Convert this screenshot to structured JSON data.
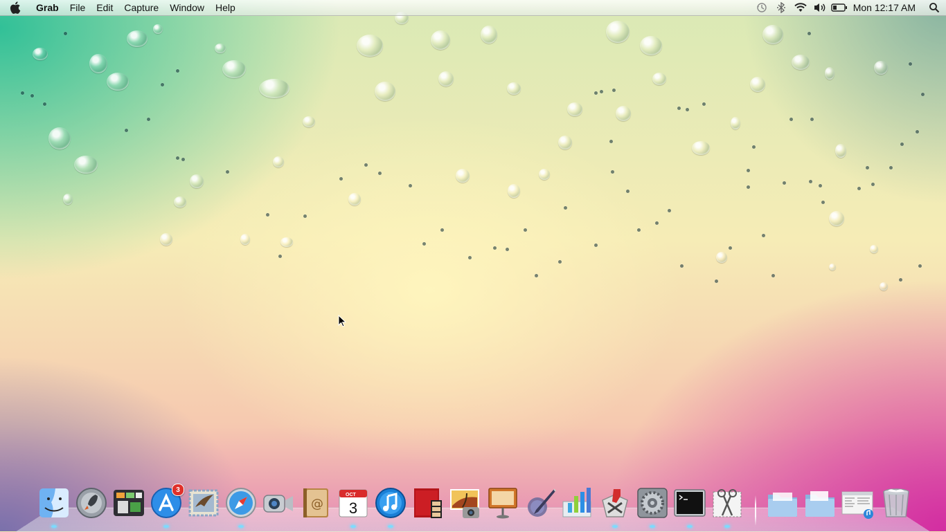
{
  "menubar": {
    "apple_icon": "apple-logo-icon",
    "app_name": "Grab",
    "menus": [
      "File",
      "Edit",
      "Capture",
      "Window",
      "Help"
    ],
    "status_icons": [
      "time-machine-icon",
      "bluetooth-icon",
      "wifi-icon",
      "volume-icon",
      "battery-icon"
    ],
    "clock": "Mon 12:17 AM",
    "spotlight_icon": "spotlight-search-icon"
  },
  "dock": {
    "apps": [
      {
        "name": "Finder",
        "icon": "finder-icon",
        "running": true
      },
      {
        "name": "Launchpad",
        "icon": "launchpad-icon",
        "running": false
      },
      {
        "name": "Mission Control",
        "icon": "mission-control-icon",
        "running": false
      },
      {
        "name": "App Store",
        "icon": "app-store-icon",
        "running": true,
        "badge": "3"
      },
      {
        "name": "Mail",
        "icon": "mail-icon",
        "running": false
      },
      {
        "name": "Safari",
        "icon": "safari-icon",
        "running": true
      },
      {
        "name": "FaceTime",
        "icon": "facetime-icon",
        "running": false
      },
      {
        "name": "Address Book",
        "icon": "address-book-icon",
        "running": false
      },
      {
        "name": "iCal",
        "icon": "calendar-icon",
        "running": true,
        "calendar_month": "OCT",
        "calendar_day": "3"
      },
      {
        "name": "iTunes",
        "icon": "itunes-icon",
        "running": true
      },
      {
        "name": "Photo Booth",
        "icon": "photo-booth-icon",
        "running": false
      },
      {
        "name": "iPhoto",
        "icon": "iphoto-icon",
        "running": false
      },
      {
        "name": "Keynote",
        "icon": "keynote-icon",
        "running": false
      },
      {
        "name": "Script Editor",
        "icon": "script-editor-icon",
        "running": false
      },
      {
        "name": "Numbers",
        "icon": "numbers-icon",
        "running": false
      },
      {
        "name": "Xcode",
        "icon": "xcode-icon",
        "running": true
      },
      {
        "name": "System Preferences",
        "icon": "system-preferences-icon",
        "running": true
      },
      {
        "name": "Terminal",
        "icon": "terminal-icon",
        "running": true
      },
      {
        "name": "Grab",
        "icon": "grab-icon",
        "running": true
      },
      {
        "name": "Applications",
        "icon": "folder-icon",
        "running": false
      },
      {
        "name": "Documents",
        "icon": "folder-icon",
        "running": false
      },
      {
        "name": "Downloads",
        "icon": "downloads-stack-icon",
        "running": false
      },
      {
        "name": "Trash",
        "icon": "trash-icon",
        "running": false
      }
    ]
  },
  "colors": {
    "dock_indicator": "#78dcff",
    "badge": "#e0302a",
    "wallpaper_top_left": "#28be96",
    "wallpaper_center": "#fff6be",
    "wallpaper_bottom_right": "#d228a0"
  }
}
